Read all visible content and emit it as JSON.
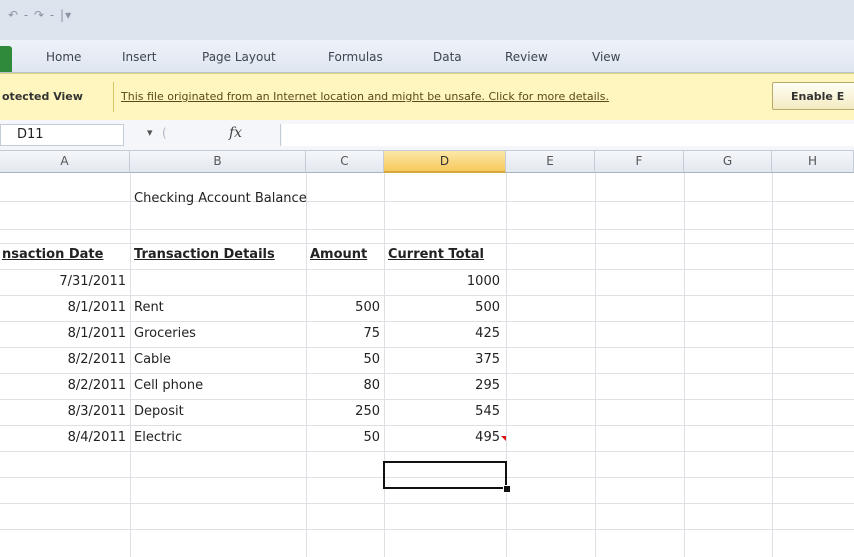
{
  "quick_access": {
    "icons": [
      "undo-icon",
      "redo-icon",
      "customize-icon"
    ],
    "glyphs": "↶ - ↷ - |▾"
  },
  "ribbon": {
    "tabs": [
      "Home",
      "Insert",
      "Page Layout",
      "Formulas",
      "Data",
      "Review",
      "View"
    ]
  },
  "protected_view": {
    "title": "otected View",
    "message": "This file originated from an Internet location and might be unsafe. Click for more details.",
    "button": "Enable E"
  },
  "formula_bar": {
    "name_box": "D11",
    "fx": "fx",
    "content": ""
  },
  "columns": [
    "A",
    "B",
    "C",
    "D",
    "E",
    "F",
    "G",
    "H"
  ],
  "sheet": {
    "title": "Checking Account Balance",
    "headers": [
      "nsaction Date",
      "Transaction Details",
      "Amount",
      "Current Total"
    ],
    "rows": [
      [
        "7/31/2011",
        "",
        "",
        "1000"
      ],
      [
        "8/1/2011",
        "Rent",
        "500",
        "500"
      ],
      [
        "8/1/2011",
        "Groceries",
        "75",
        "425"
      ],
      [
        "8/2/2011",
        "Cable",
        "50",
        "375"
      ],
      [
        "8/2/2011",
        "Cell phone",
        "80",
        "295"
      ],
      [
        "8/3/2011",
        "Deposit",
        "250",
        "545"
      ],
      [
        "8/4/2011",
        "Electric",
        "50",
        "495"
      ]
    ]
  },
  "colors": {
    "file_tab": "#2f8a3b",
    "protected_bar": "#fff6bf",
    "selected_header": "#f6c95c",
    "comment_flag": "#dd1111"
  }
}
